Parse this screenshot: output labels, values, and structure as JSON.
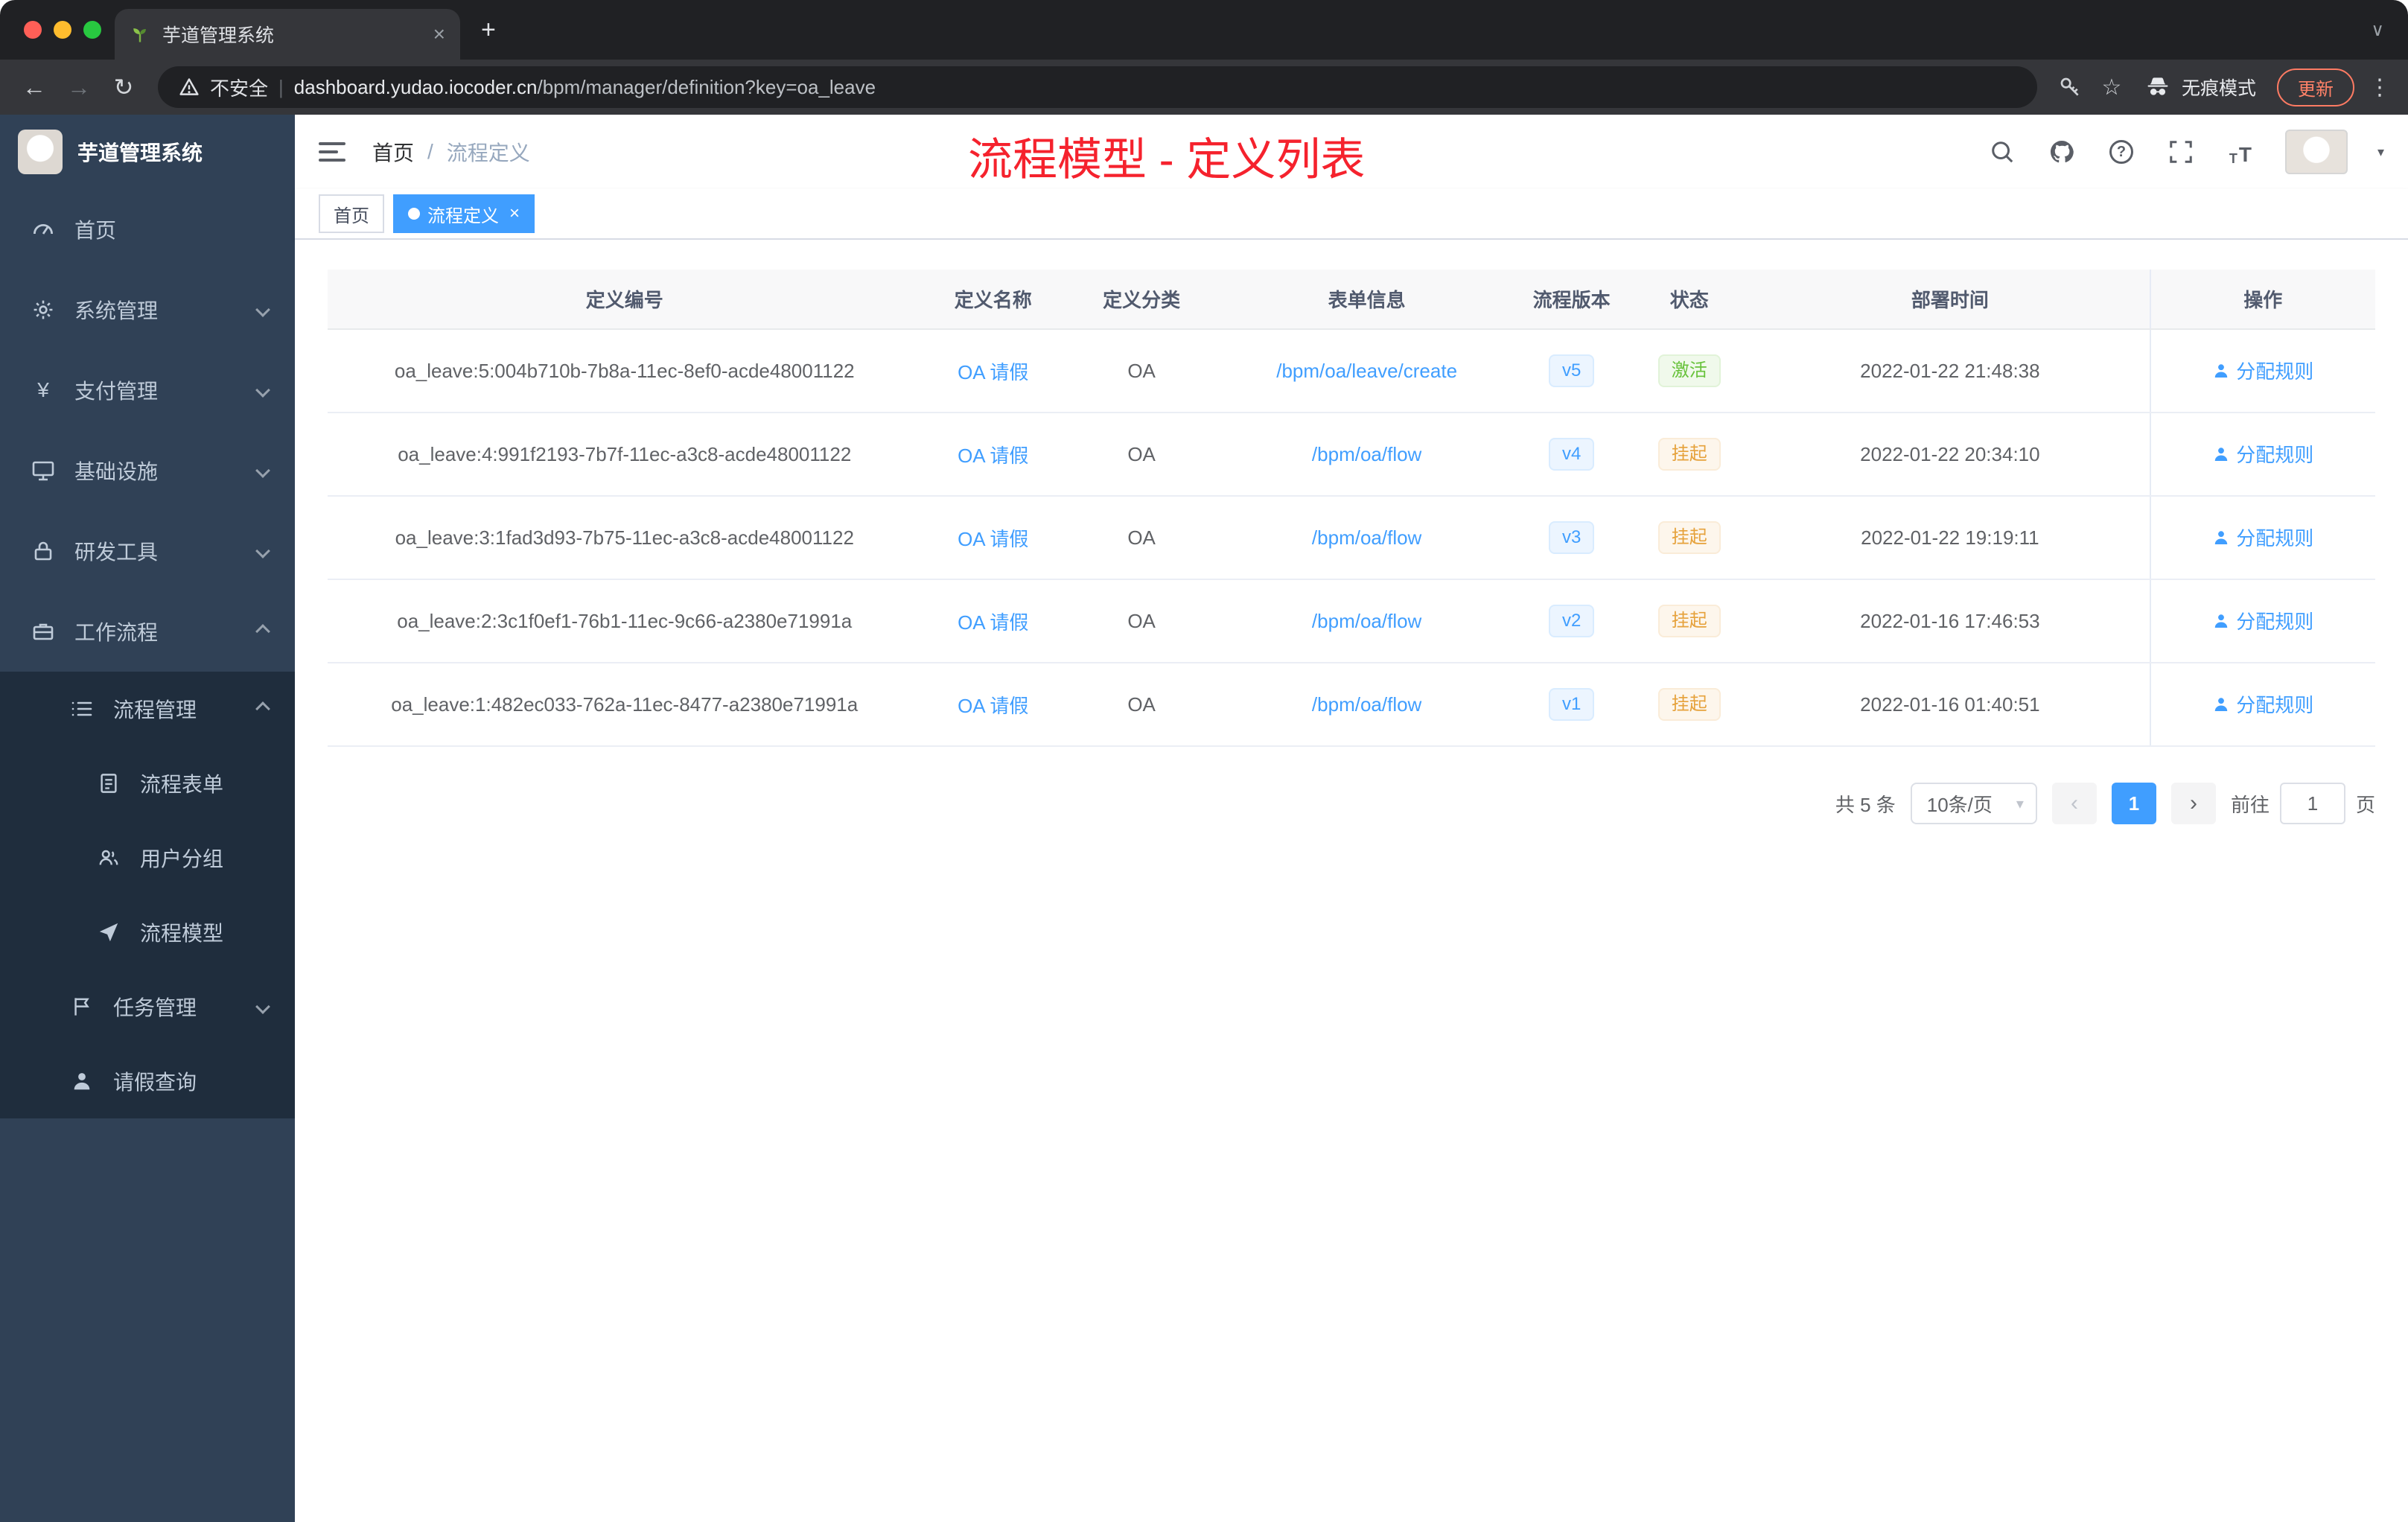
{
  "colors": {
    "accent": "#409eff",
    "success": "#67c23a",
    "warning": "#e6a23c",
    "annotation_red": "#f5222d",
    "sidebar_bg": "#304156",
    "submenu_bg": "#1f2d3d"
  },
  "icons": {
    "back": "←",
    "forward": "→",
    "reload": "↻",
    "star": "☆",
    "kebab": "⋮",
    "plus": "+",
    "close": "×",
    "caret_down": "▾",
    "tab_search": "∨",
    "prev": "‹",
    "next": "›",
    "pipe": "|",
    "yen": "¥",
    "help": "?",
    "fontsize_big": "T",
    "fontsize_small": "T"
  },
  "browser": {
    "tab_title": "芋道管理系统",
    "security_label": "不安全",
    "url_host": "dashboard.yudao.iocoder.cn",
    "url_path": "/bpm/manager/definition?key=oa_leave",
    "incognito_label": "无痕模式",
    "update_label": "更新"
  },
  "sidebar": {
    "logo_title": "芋道管理系统",
    "items": [
      {
        "label": "首页"
      },
      {
        "label": "系统管理"
      },
      {
        "label": "支付管理"
      },
      {
        "label": "基础设施"
      },
      {
        "label": "研发工具"
      },
      {
        "label": "工作流程"
      },
      {
        "label": "流程管理"
      },
      {
        "label": "流程表单"
      },
      {
        "label": "用户分组"
      },
      {
        "label": "流程模型"
      },
      {
        "label": "任务管理"
      },
      {
        "label": "请假查询"
      }
    ]
  },
  "header": {
    "breadcrumb_home": "首页",
    "breadcrumb_separator": "/",
    "breadcrumb_current": "流程定义",
    "annotation": "流程模型 - 定义列表"
  },
  "tags": {
    "home": "首页",
    "active": "流程定义"
  },
  "table": {
    "columns": [
      "定义编号",
      "定义名称",
      "定义分类",
      "表单信息",
      "流程版本",
      "状态",
      "部署时间",
      "操作"
    ],
    "rows": [
      {
        "id": "oa_leave:5:004b710b-7b8a-11ec-8ef0-acde48001122",
        "name": "OA 请假",
        "category": "OA",
        "form": "/bpm/oa/leave/create",
        "version": "v5",
        "status": "激活",
        "time": "2022-01-22 21:48:38",
        "action": "分配规则"
      },
      {
        "id": "oa_leave:4:991f2193-7b7f-11ec-a3c8-acde48001122",
        "name": "OA 请假",
        "category": "OA",
        "form": "/bpm/oa/flow",
        "version": "v4",
        "status": "挂起",
        "time": "2022-01-22 20:34:10",
        "action": "分配规则"
      },
      {
        "id": "oa_leave:3:1fad3d93-7b75-11ec-a3c8-acde48001122",
        "name": "OA 请假",
        "category": "OA",
        "form": "/bpm/oa/flow",
        "version": "v3",
        "status": "挂起",
        "time": "2022-01-22 19:19:11",
        "action": "分配规则"
      },
      {
        "id": "oa_leave:2:3c1f0ef1-76b1-11ec-9c66-a2380e71991a",
        "name": "OA 请假",
        "category": "OA",
        "form": "/bpm/oa/flow",
        "version": "v2",
        "status": "挂起",
        "time": "2022-01-16 17:46:53",
        "action": "分配规则"
      },
      {
        "id": "oa_leave:1:482ec033-762a-11ec-8477-a2380e71991a",
        "name": "OA 请假",
        "category": "OA",
        "form": "/bpm/oa/flow",
        "version": "v1",
        "status": "挂起",
        "time": "2022-01-16 01:40:51",
        "action": "分配规则"
      }
    ]
  },
  "pagination": {
    "total": "共 5 条",
    "page_size": "10条/页",
    "current_page": "1",
    "goto_label": "前往",
    "goto_value": "1",
    "page_unit": "页"
  }
}
